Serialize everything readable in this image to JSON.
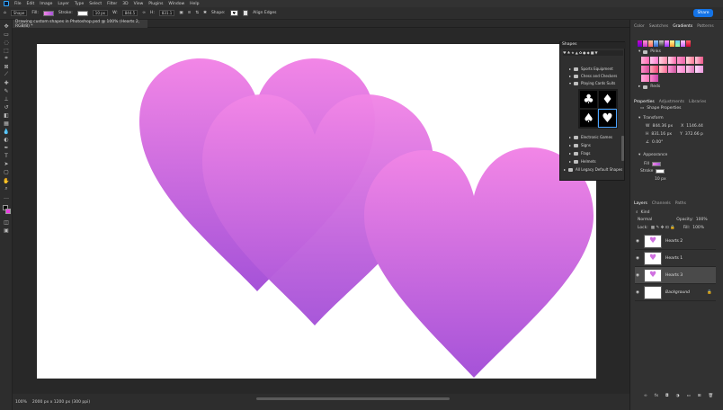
{
  "menubar": {
    "items": [
      "File",
      "Edit",
      "Image",
      "Layer",
      "Type",
      "Select",
      "Filter",
      "3D",
      "View",
      "Plugins",
      "Window",
      "Help"
    ]
  },
  "options": {
    "tool": "Shape",
    "fill_label": "Fill:",
    "stroke_label": "Stroke:",
    "stroke_width": "10 px",
    "w_label": "W:",
    "w_value": "844.5",
    "h_label": "H:",
    "h_value": "831.1",
    "shape_label": "Shape:",
    "align_edges": "Align Edges",
    "share": "Share"
  },
  "document": {
    "tab": "Drawing custom shapes in Photoshop.psd @ 100% (Hearts 2, RGB/8) *",
    "status_zoom": "100%",
    "status_size": "2000 px x 1200 px (300 ppi)"
  },
  "colors": {
    "heart_top": "#f286e6",
    "heart_bottom": "#a552d8",
    "accent": "#1473e6",
    "background": "#282828"
  },
  "panels": {
    "top_tabs": [
      "Color",
      "Swatches",
      "Gradients",
      "Patterns"
    ],
    "grad_groups": [
      "Pinks",
      "Reds"
    ],
    "shapes_title": "Shapes",
    "shape_groups": [
      "Sports Equipment",
      "Chess and Checkers",
      "Playing Cards Suits",
      "Electronic Games",
      "Signs",
      "Flags",
      "Helmets",
      "All Legacy Default Shapes"
    ],
    "props_tabs": [
      "Properties",
      "Adjustments",
      "Libraries"
    ],
    "props_type": "Shape Properties",
    "transform_label": "Transform",
    "w_val": "844.36 px",
    "x_val": "1146.44",
    "h_val": "831.16 px",
    "y_val": "372.66 p",
    "angle": "0.00°",
    "appearance_label": "Appearance",
    "fill_label": "Fill",
    "stroke_label": "Stroke",
    "stroke_px": "10 px",
    "layers_tabs": [
      "Layers",
      "Channels",
      "Paths"
    ],
    "kind": "Kind",
    "blend": "Normal",
    "opacity_label": "Opacity:",
    "opacity": "100%",
    "lock_label": "Lock:",
    "fill_pct_label": "Fill:",
    "fill_pct": "100%",
    "layers": [
      "Hearts 2",
      "Hearts 1",
      "Hearts 3",
      "Background"
    ]
  }
}
